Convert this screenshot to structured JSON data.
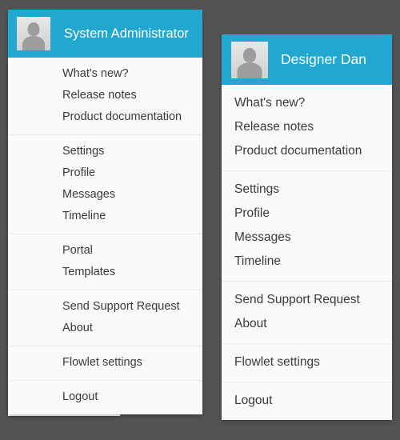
{
  "background_color": "#555454",
  "accent_color": "#22a7d0",
  "menu_background_color": "#fafafa",
  "menu_text_color": "#3a3a3a",
  "header_text_color": "#ffffff",
  "panels": [
    {
      "id": "left",
      "user_name": "System Administrator",
      "avatar_icon": "user-avatar-placeholder-icon",
      "groups": [
        {
          "items": [
            "What's new?",
            "Release notes",
            "Product documentation"
          ]
        },
        {
          "items": [
            "Settings",
            "Profile",
            "Messages",
            "Timeline"
          ]
        },
        {
          "items": [
            "Portal",
            "Templates"
          ]
        },
        {
          "items": [
            "Send Support Request",
            "About"
          ]
        },
        {
          "items": [
            "Flowlet settings"
          ]
        },
        {
          "items": [
            "Logout"
          ]
        }
      ]
    },
    {
      "id": "right",
      "user_name": "Designer Dan",
      "avatar_icon": "user-avatar-placeholder-icon",
      "groups": [
        {
          "items": [
            "What's new?",
            "Release notes",
            "Product documentation"
          ]
        },
        {
          "items": [
            "Settings",
            "Profile",
            "Messages",
            "Timeline"
          ]
        },
        {
          "items": [
            "Send Support Request",
            "About"
          ]
        },
        {
          "items": [
            "Flowlet settings"
          ]
        },
        {
          "items": [
            "Logout"
          ]
        }
      ]
    }
  ]
}
